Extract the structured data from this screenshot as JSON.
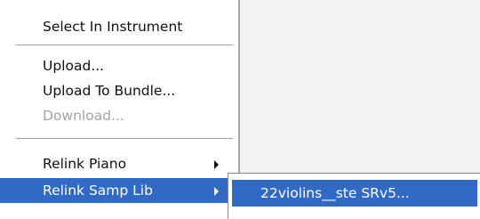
{
  "context_menu": {
    "items": [
      {
        "label": "Select In Instrument",
        "state": "enabled",
        "has_submenu": false
      },
      {
        "label": "Upload...",
        "state": "enabled",
        "has_submenu": false
      },
      {
        "label": "Upload To Bundle...",
        "state": "enabled",
        "has_submenu": false
      },
      {
        "label": "Download...",
        "state": "disabled",
        "has_submenu": false
      },
      {
        "label": "Relink Piano",
        "state": "enabled",
        "has_submenu": true
      },
      {
        "label": "Relink Samp Lib",
        "state": "highlighted",
        "has_submenu": true
      }
    ],
    "arrow_icon": "chevron-right-icon",
    "colors": {
      "highlight": "#316ac5",
      "highlight_text": "#ffffff",
      "text": "#111111",
      "disabled_text": "#a4a4a4",
      "background": "#ffffff"
    }
  },
  "submenu": {
    "items": [
      {
        "label": "22violins__ste SRv5...",
        "state": "highlighted"
      }
    ]
  }
}
